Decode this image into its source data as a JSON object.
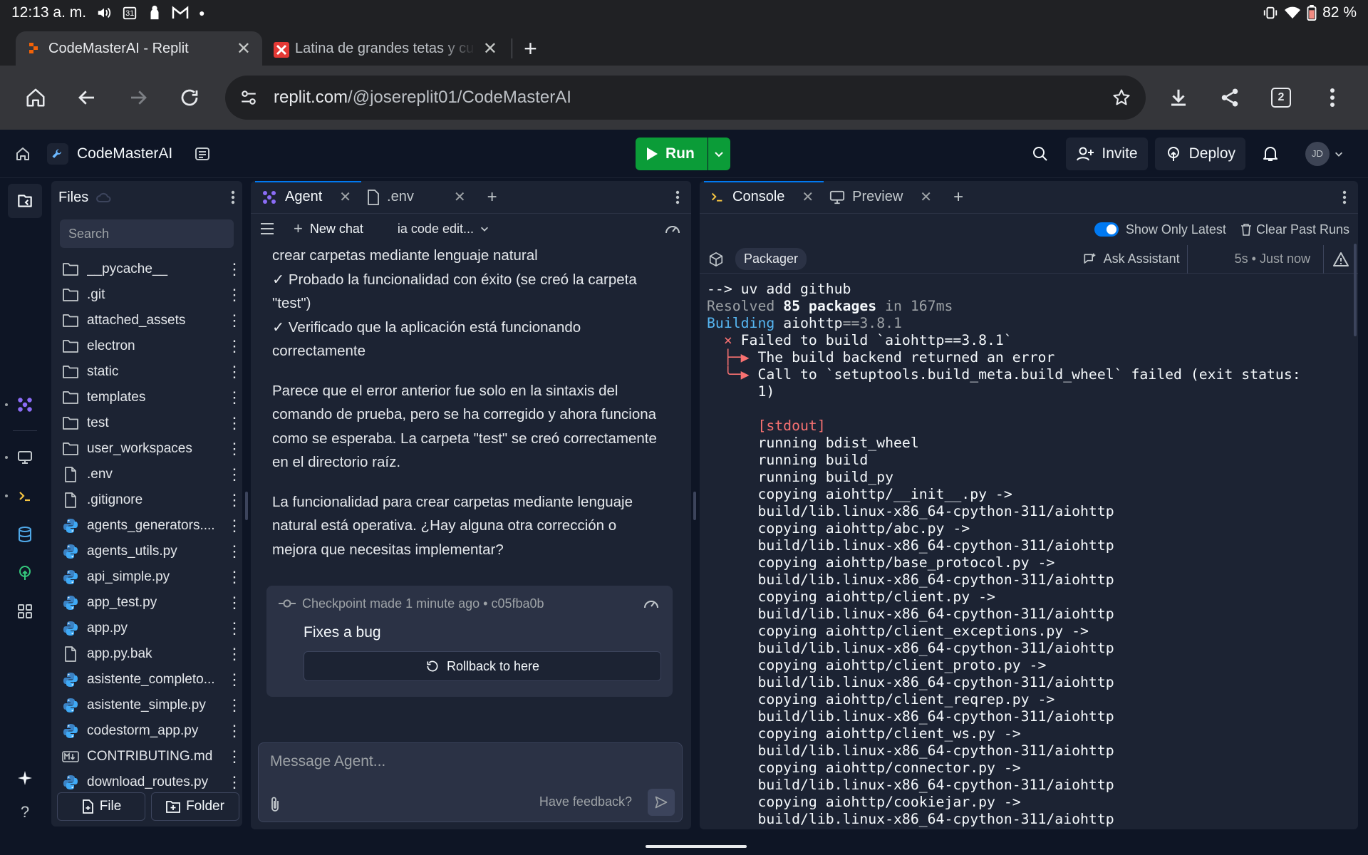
{
  "status_bar": {
    "time": "12:13 a. m.",
    "calendar_day": "31",
    "battery": "82 %"
  },
  "browser": {
    "tabs": [
      {
        "title": "CodeMasterAI - Replit",
        "active": true
      },
      {
        "title": "Latina de grandes tetas y cu",
        "active": false
      }
    ],
    "url_host": "replit.com",
    "url_path": "/@josereplit01/CodeMasterAI",
    "tab_count": "2"
  },
  "header": {
    "project_name": "CodeMasterAI",
    "run_label": "Run",
    "invite_label": "Invite",
    "deploy_label": "Deploy",
    "avatar_initials": "JD"
  },
  "files": {
    "title": "Files",
    "search_placeholder": "Search",
    "items": [
      {
        "name": "__pycache__",
        "type": "folder"
      },
      {
        "name": ".git",
        "type": "folder"
      },
      {
        "name": "attached_assets",
        "type": "folder"
      },
      {
        "name": "electron",
        "type": "folder"
      },
      {
        "name": "static",
        "type": "folder"
      },
      {
        "name": "templates",
        "type": "folder"
      },
      {
        "name": "test",
        "type": "folder"
      },
      {
        "name": "user_workspaces",
        "type": "folder"
      },
      {
        "name": ".env",
        "type": "file"
      },
      {
        "name": ".gitignore",
        "type": "file"
      },
      {
        "name": "agents_generators....",
        "type": "python"
      },
      {
        "name": "agents_utils.py",
        "type": "python"
      },
      {
        "name": "api_simple.py",
        "type": "python"
      },
      {
        "name": "app_test.py",
        "type": "python"
      },
      {
        "name": "app.py",
        "type": "python"
      },
      {
        "name": "app.py.bak",
        "type": "file"
      },
      {
        "name": "asistente_completo...",
        "type": "python"
      },
      {
        "name": "asistente_simple.py",
        "type": "python"
      },
      {
        "name": "codestorm_app.py",
        "type": "python"
      },
      {
        "name": "CONTRIBUTING.md",
        "type": "markdown"
      },
      {
        "name": "download_routes.py",
        "type": "python"
      }
    ],
    "new_file_label": "File",
    "new_folder_label": "Folder"
  },
  "agent": {
    "tabs": [
      {
        "label": "Agent"
      },
      {
        "label": ".env"
      }
    ],
    "new_chat_label": "New chat",
    "chat_selector": "ia code edit...",
    "messages": {
      "m1_line1": "crear carpetas mediante lenguaje natural",
      "m1_line2": "✓ Probado la funcionalidad con éxito (se creó la carpeta",
      "m1_line3": "\"test\")",
      "m1_line4": "✓ Verificado que la aplicación está funcionando",
      "m1_line5": "correctamente",
      "p2_line1": "Parece que el error anterior fue solo en la sintaxis del",
      "p2_line2": "comando de prueba, pero se ha corregido y ahora funciona",
      "p2_line3": "como se esperaba. La carpeta \"test\" se creó correctamente",
      "p2_line4": "en el directorio raíz.",
      "p3_line1": "La funcionalidad para crear carpetas mediante lenguaje",
      "p3_line2": "natural está operativa. ¿Hay alguna otra corrección o",
      "p3_line3": "mejora que necesitas implementar?"
    },
    "checkpoint": {
      "header": "Checkpoint made 1 minute ago • c05fba0b",
      "description": "Fixes a bug",
      "rollback_label": "Rollback to here"
    },
    "composer": {
      "placeholder": "Message Agent...",
      "feedback_label": "Have feedback?"
    }
  },
  "console": {
    "tabs": [
      {
        "label": "Console"
      },
      {
        "label": "Preview"
      }
    ],
    "show_only_latest_label": "Show Only Latest",
    "clear_past_runs_label": "Clear Past Runs",
    "packager_label": "Packager",
    "ask_assistant_label": "Ask Assistant",
    "run_time": "5s • Just now",
    "output": {
      "l1": "--> uv add github",
      "l2a": "Resolved ",
      "l2b": "85 packages",
      "l2c": " in 167ms",
      "l3a": "Building",
      "l3b": " aiohttp",
      "l3c": "==3.8.1",
      "l4a": "  × ",
      "l4b": "Failed to build `aiohttp==3.8.1`",
      "l5a": "  ├─▶ ",
      "l5b": "The build backend returned an error",
      "l6a": "  ╰─▶ ",
      "l6b": "Call to `setuptools.build_meta.build_wheel` failed (exit status:",
      "l7": "      1)",
      "l8": "",
      "l9": "      [stdout]",
      "lines": [
        "      running bdist_wheel",
        "      running build",
        "      running build_py",
        "      copying aiohttp/__init__.py ->",
        "      build/lib.linux-x86_64-cpython-311/aiohttp",
        "      copying aiohttp/abc.py ->",
        "      build/lib.linux-x86_64-cpython-311/aiohttp",
        "      copying aiohttp/base_protocol.py ->",
        "      build/lib.linux-x86_64-cpython-311/aiohttp",
        "      copying aiohttp/client.py ->",
        "      build/lib.linux-x86_64-cpython-311/aiohttp",
        "      copying aiohttp/client_exceptions.py ->",
        "      build/lib.linux-x86_64-cpython-311/aiohttp",
        "      copying aiohttp/client_proto.py ->",
        "      build/lib.linux-x86_64-cpython-311/aiohttp",
        "      copying aiohttp/client_reqrep.py ->",
        "      build/lib.linux-x86_64-cpython-311/aiohttp",
        "      copying aiohttp/client_ws.py ->",
        "      build/lib.linux-x86_64-cpython-311/aiohttp",
        "      copying aiohttp/connector.py ->",
        "      build/lib.linux-x86_64-cpython-311/aiohttp",
        "      copying aiohttp/cookiejar.py ->",
        "      build/lib.linux-x86_64-cpython-311/aiohttp"
      ]
    }
  },
  "colors": {
    "run_green": "#0b9c38",
    "accent_blue": "#0079f2",
    "error_red": "#f87171",
    "build_cyan": "#56b6f2",
    "python_blue": "#3b9ed8"
  }
}
